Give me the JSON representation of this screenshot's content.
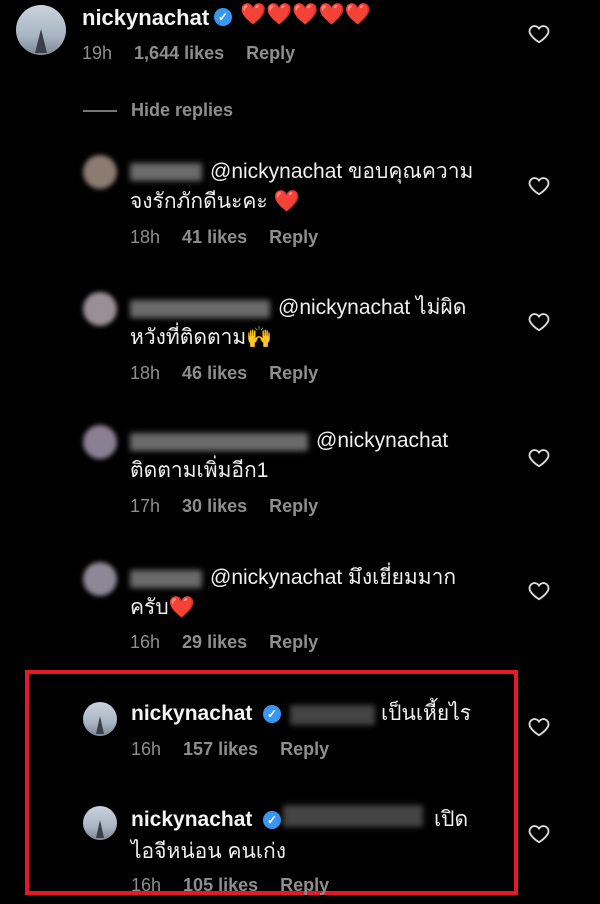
{
  "main_comment": {
    "username": "nickynachat",
    "text": "❤️❤️❤️❤️❤️",
    "time": "19h",
    "likes": "1,644 likes",
    "reply": "Reply"
  },
  "hide_replies": "Hide replies",
  "replies": [
    {
      "mention": "@nickynachat ขอบคุณความ",
      "line2": "จงรักภักดีนะคะ ❤️",
      "time": "18h",
      "likes": "41 likes",
      "reply": "Reply"
    },
    {
      "mention": "@nickynachat ไม่ผิด",
      "line2": "หวังที่ติดตาม🙌",
      "time": "18h",
      "likes": "46 likes",
      "reply": "Reply"
    },
    {
      "mention": "@nickynachat",
      "line2": "ติดตามเพิ่มอีก1",
      "time": "17h",
      "likes": "30 likes",
      "reply": "Reply"
    },
    {
      "mention": "@nickynachat มึงเยี่ยมมาก",
      "line2": "ครับ❤️",
      "time": "16h",
      "likes": "29 likes",
      "reply": "Reply"
    }
  ],
  "highlighted": [
    {
      "username": "nickynachat",
      "text": "เป็นเหี้ยไร",
      "time": "16h",
      "likes": "157 likes",
      "reply": "Reply"
    },
    {
      "username": "nickynachat",
      "text": "เปิด",
      "line2": "ไอจีหน่อน คนเก่ง",
      "time": "16h",
      "likes": "105 likes",
      "reply": "Reply"
    }
  ],
  "colors": {
    "highlight_border": "#e6192a",
    "verified": "#3897f0",
    "muted": "#8e8e8e"
  }
}
